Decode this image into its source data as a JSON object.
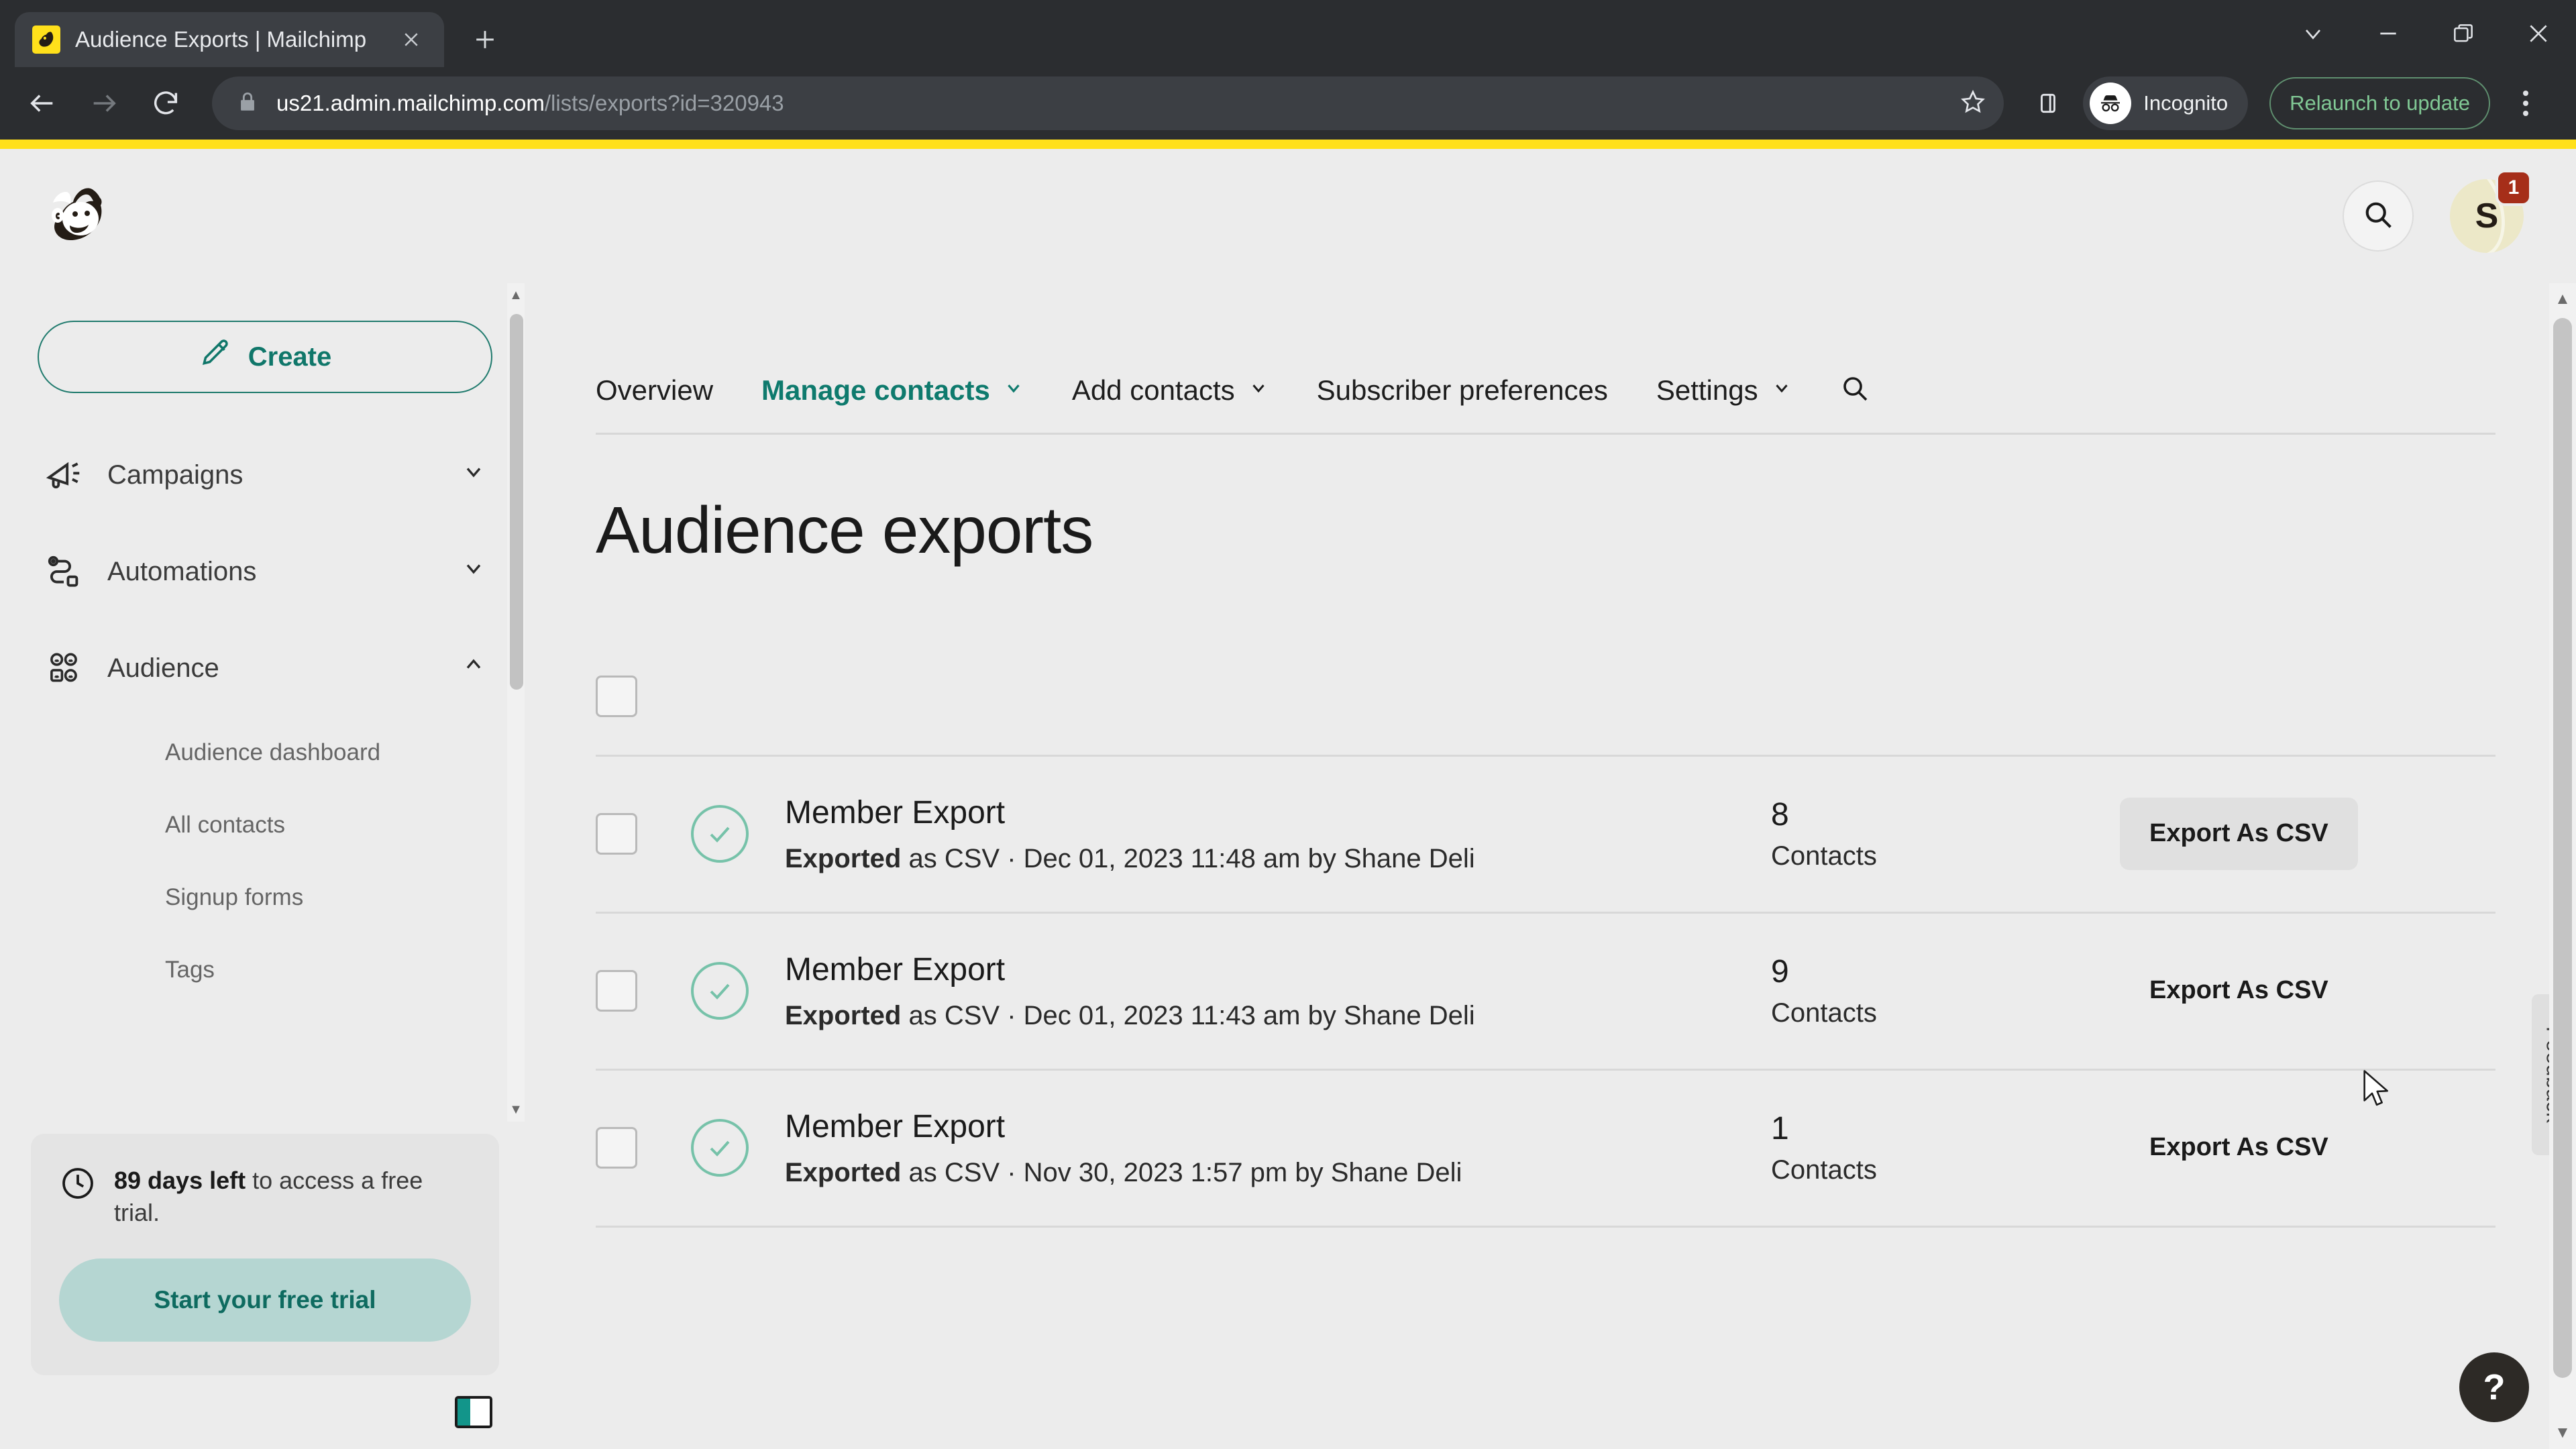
{
  "browser": {
    "tab": {
      "title": "Audience Exports | Mailchimp",
      "favicon": "mailchimp-favicon",
      "close_label": "×"
    },
    "newtab_label": "+",
    "window_controls": {
      "minimize_all": "chevron-down",
      "minimize": "minimize",
      "maximize": "maximize",
      "close": "close"
    },
    "nav": {
      "back": "back-arrow",
      "forward": "forward-arrow",
      "reload": "reload"
    },
    "omnibox": {
      "lock": "lock-icon",
      "url_host": "us21.admin.mailchimp.com",
      "url_path": "/lists/exports?id=320943",
      "full_url": "us21.admin.mailchimp.com/lists/exports?id=320943",
      "bookmark": "star-icon"
    },
    "side_panel": "side-panel-icon",
    "incognito_label": "Incognito",
    "relaunch_label": "Relaunch to update",
    "menu": "three-dot-menu"
  },
  "brand": {
    "accent_yellow": "#ffe01b",
    "teal": "#0e7a6d",
    "badge_red": "#a62e19",
    "check_green": "#76c2a9"
  },
  "header": {
    "logo": "mailchimp-freddie-logo",
    "search_icon": "search-icon",
    "avatar_initial": "S",
    "badge_count": "1"
  },
  "sidebar": {
    "create_label": "Create",
    "create_icon": "pencil-icon",
    "items": [
      {
        "label": "Campaigns",
        "icon": "megaphone-icon",
        "chevron": "chevron-down",
        "expanded": false
      },
      {
        "label": "Automations",
        "icon": "automation-flow-icon",
        "chevron": "chevron-down",
        "expanded": false
      },
      {
        "label": "Audience",
        "icon": "audience-people-icon",
        "chevron": "chevron-up",
        "expanded": true
      }
    ],
    "sub_items": [
      {
        "label": "Audience dashboard"
      },
      {
        "label": "All contacts"
      },
      {
        "label": "Signup forms"
      },
      {
        "label": "Tags"
      }
    ],
    "trial": {
      "icon": "clock-icon",
      "days_bold": "89 days left",
      "days_rest": " to access a free trial.",
      "cta_label": "Start your free trial"
    },
    "panel_toggle": "panel-toggle-icon"
  },
  "nav_tabs": [
    {
      "label": "Overview",
      "active": false,
      "has_chevron": false
    },
    {
      "label": "Manage contacts",
      "active": true,
      "has_chevron": true
    },
    {
      "label": "Add contacts",
      "active": false,
      "has_chevron": true
    },
    {
      "label": "Subscriber preferences",
      "active": false,
      "has_chevron": false
    },
    {
      "label": "Settings",
      "active": false,
      "has_chevron": true
    }
  ],
  "nav_search_icon": "search-icon",
  "main": {
    "page_title": "Audience exports",
    "select_all_checkbox": "unchecked",
    "export_rows": [
      {
        "status_icon": "check-circle-icon",
        "title": "Member Export",
        "sub_bold": "Exported",
        "sub_rest": " as CSV · Dec 01, 2023 11:48 am by Shane Deli",
        "count": "8",
        "count_label": "Contacts",
        "action_label": "Export As CSV",
        "hovered": true
      },
      {
        "status_icon": "check-circle-icon",
        "title": "Member Export",
        "sub_bold": "Exported",
        "sub_rest": " as CSV · Dec 01, 2023 11:43 am by Shane Deli",
        "count": "9",
        "count_label": "Contacts",
        "action_label": "Export As CSV",
        "hovered": false
      },
      {
        "status_icon": "check-circle-icon",
        "title": "Member Export",
        "sub_bold": "Exported",
        "sub_rest": " as CSV · Nov 30, 2023 1:57 pm by Shane Deli",
        "count": "1",
        "count_label": "Contacts",
        "action_label": "Export As CSV",
        "hovered": false
      }
    ]
  },
  "feedback_label": "Feedback",
  "help_label": "?"
}
